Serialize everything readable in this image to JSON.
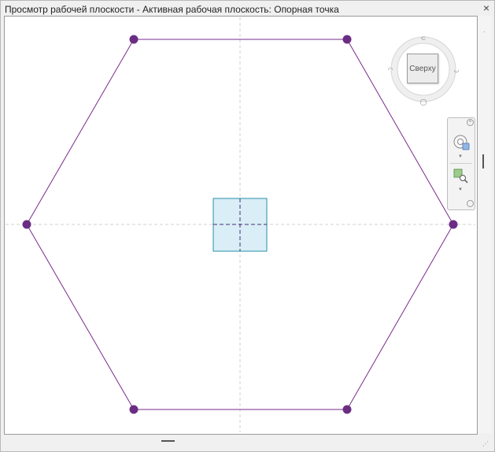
{
  "window": {
    "title": "Просмотр рабочей плоскости - Активная рабочая плоскость: Опорная точка",
    "close_glyph": "×"
  },
  "viewcube": {
    "face_label": "Сверху"
  },
  "navbar": {
    "tools": [
      "steering-wheel-icon",
      "zoom-region-icon"
    ]
  },
  "colors": {
    "hexagon_stroke": "#7a2a8c",
    "point_fill": "#6b2d83",
    "reference_fill": "#d6eef7",
    "reference_stroke": "#2a8aa6",
    "axis_dash": "#cfcfcf"
  }
}
